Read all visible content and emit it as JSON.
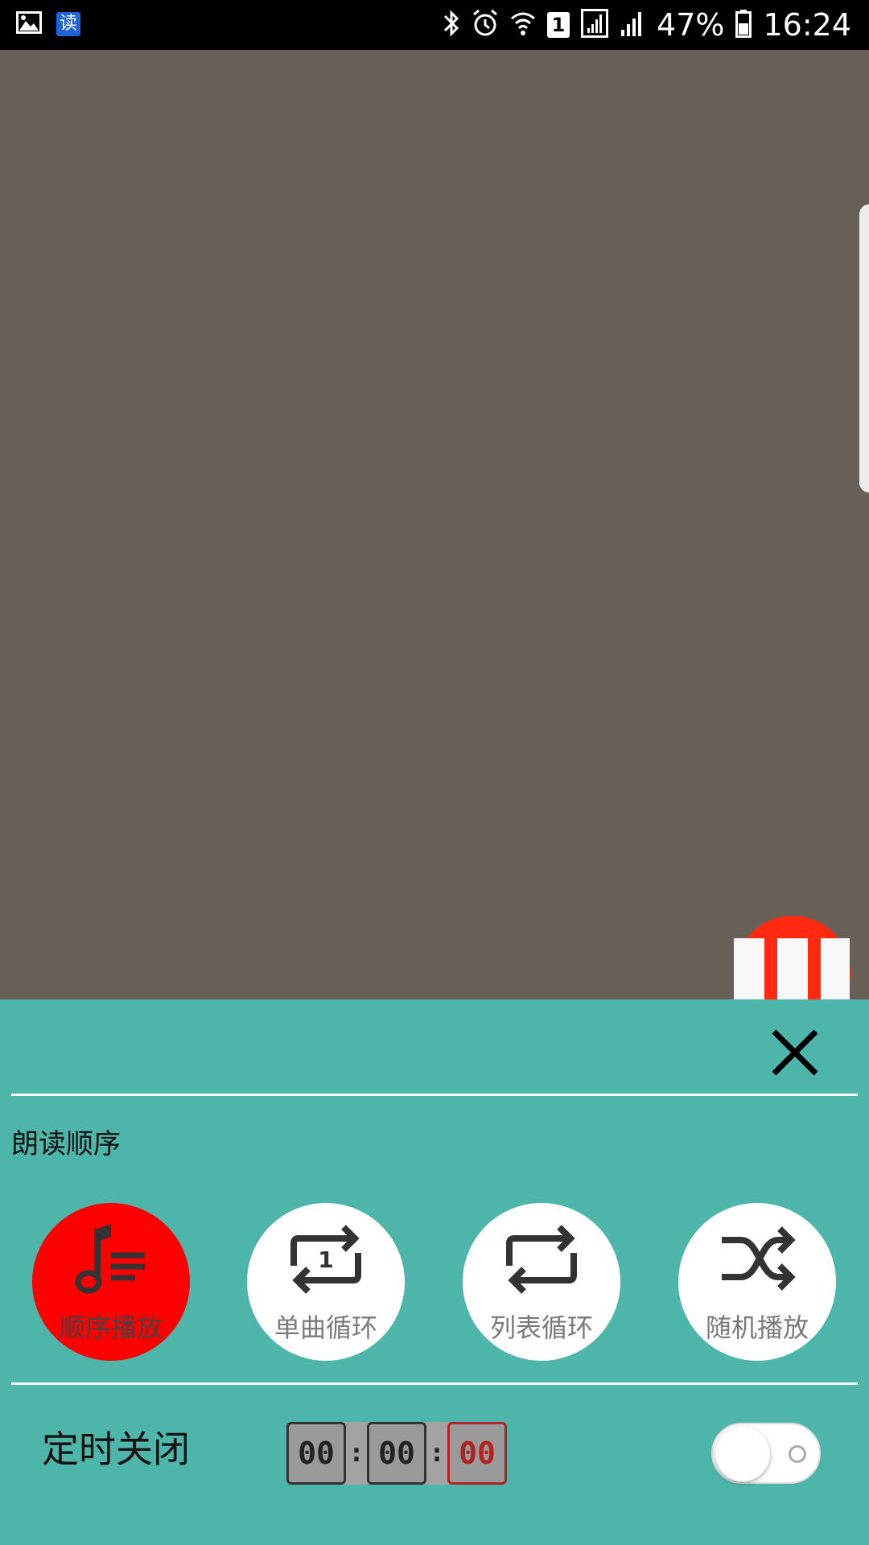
{
  "status_bar": {
    "app_badge": "读",
    "sim": "1",
    "battery": "47%",
    "time": "16:24"
  },
  "sheet": {
    "section_title": "朗读顺序",
    "modes": [
      {
        "label": "顺序播放",
        "icon": "music-list-icon",
        "active": true
      },
      {
        "label": "单曲循环",
        "icon": "repeat-one-icon",
        "active": false
      },
      {
        "label": "列表循环",
        "icon": "repeat-icon",
        "active": false
      },
      {
        "label": "随机播放",
        "icon": "shuffle-icon",
        "active": false
      }
    ],
    "timer": {
      "label": "定时关闭",
      "hours": "00",
      "minutes": "00",
      "seconds": "00",
      "separator": ":",
      "enabled": false
    }
  },
  "colors": {
    "sheet_bg": "#4db5aa",
    "active_mode": "#ff0000",
    "fab": "#ff2a0f",
    "content_bg": "#676057"
  }
}
